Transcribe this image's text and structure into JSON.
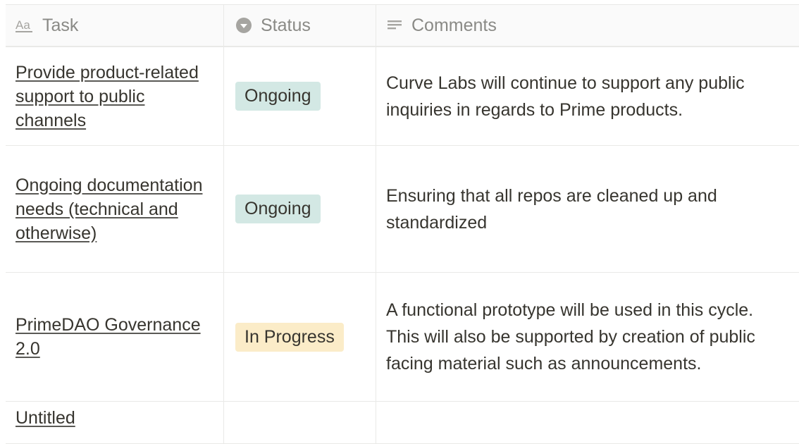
{
  "header": {
    "task": {
      "icon": "text-aa-icon",
      "label": "Task"
    },
    "status": {
      "icon": "select-dropdown-icon",
      "label": "Status"
    },
    "comments": {
      "icon": "text-lines-icon",
      "label": "Comments"
    }
  },
  "rows": [
    {
      "task": "Provide product-related support to public channels",
      "status": "Ongoing",
      "status_color": "#d3e8e4",
      "comment": "Curve Labs will continue to support any public inquiries in regards to Prime products."
    },
    {
      "task": "Ongoing documentation needs (technical and otherwise)",
      "status": "Ongoing",
      "status_color": "#d3e8e4",
      "comment": "Ensuring that all repos are cleaned up and standardized"
    },
    {
      "task": "PrimeDAO Governance 2.0",
      "status": "In Progress",
      "status_color": "#fbecc8",
      "comment": "A functional prototype will be used in this cycle. This will also be supported by creation of public facing material such as announcements."
    },
    {
      "task": "Untitled",
      "status": "",
      "status_color": "",
      "comment": ""
    }
  ]
}
